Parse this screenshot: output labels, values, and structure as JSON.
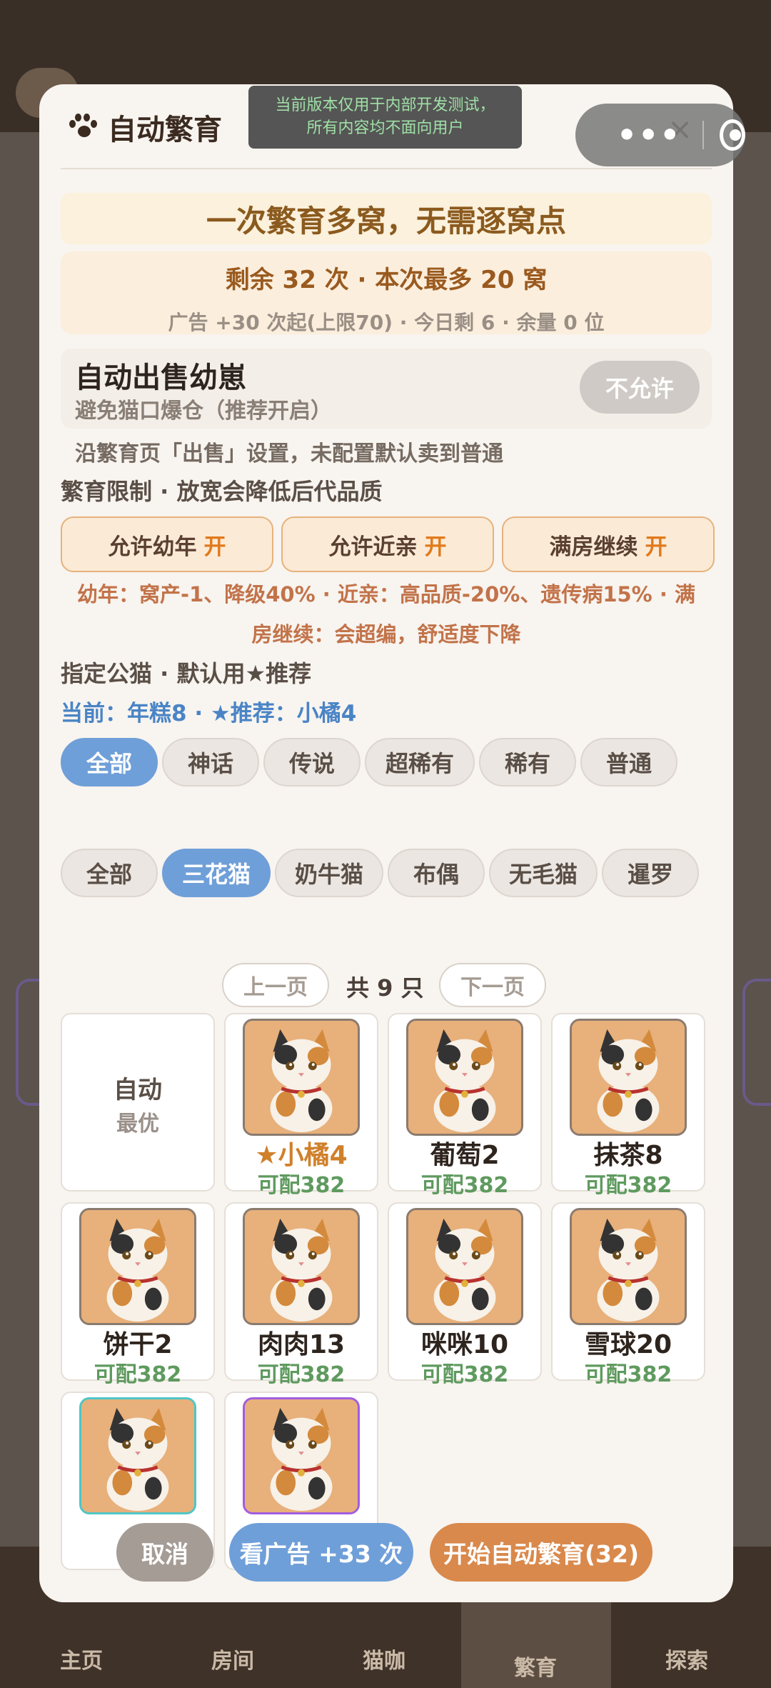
{
  "dev_banner": {
    "line1": "当前版本仅用于内部开发测试，",
    "line2": "所有内容均不面向用户"
  },
  "modal": {
    "title": "自动繁育",
    "close_icon": "×",
    "hero": "一次繁育多窝，无需逐窝点",
    "quota_main": "剩余 32 次 · 本次最多 20 窝",
    "quota_sub": "广告 +30 次起(上限70) · 今日剩 6 · 余量 0 位",
    "auto_sell": {
      "title": "自动出售幼崽",
      "subtitle": "避免猫口爆仓（推荐开启）",
      "toggle_label": "不允许",
      "hint": "沿繁育页「出售」设置，未配置默认卖到普通"
    },
    "limits": {
      "label": "繁育限制 · 放宽会降低后代品质",
      "toggles": [
        {
          "label": "允许幼年",
          "state": "开"
        },
        {
          "label": "允许近亲",
          "state": "开"
        },
        {
          "label": "满房继续",
          "state": "开"
        }
      ],
      "warning_line1": "幼年：窝产-1、降级40% · 近亲：高品质-20%、遗传病15% · 满",
      "warning_line2": "房继续：会超编，舒适度下降"
    },
    "sire": {
      "label": "指定公猫 · 默认用★推荐",
      "current": "当前：年糕8 · ★推荐：小橘4"
    },
    "rarity_filters": [
      "全部",
      "神话",
      "传说",
      "超稀有",
      "稀有",
      "普通"
    ],
    "rarity_active": "全部",
    "breed_filters": [
      "全部",
      "三花猫",
      "奶牛猫",
      "布偶",
      "无毛猫",
      "暹罗"
    ],
    "breed_active": "三花猫",
    "pager": {
      "prev": "上一页",
      "total": "共 9 只",
      "next": "下一页"
    },
    "auto_cell": {
      "main": "自动",
      "sub": "最优"
    },
    "cats": [
      {
        "name": "★小橘4",
        "pair": "可配382",
        "recommended": true
      },
      {
        "name": "葡萄2",
        "pair": "可配382"
      },
      {
        "name": "抹茶8",
        "pair": "可配382"
      },
      {
        "name": "饼干2",
        "pair": "可配382"
      },
      {
        "name": "肉肉13",
        "pair": "可配382"
      },
      {
        "name": "咪咪10",
        "pair": "可配382"
      },
      {
        "name": "雪球20",
        "pair": "可配382"
      },
      {
        "name": "",
        "pair": "",
        "frame": "teal"
      },
      {
        "name": "",
        "pair": "",
        "frame": "purple"
      }
    ],
    "buttons": {
      "cancel": "取消",
      "watch_ad": "看广告 +33 次",
      "start": "开始自动繁育(32)"
    }
  },
  "tabbar": [
    "主页",
    "房间",
    "猫咖",
    "繁育",
    "探索"
  ],
  "colors": {
    "accent_blue": "#6f9fd8",
    "accent_orange": "#d9894c",
    "toggle_on": "#e07a1c",
    "pair_green": "#5f9a5f",
    "warning": "#c2734a"
  }
}
